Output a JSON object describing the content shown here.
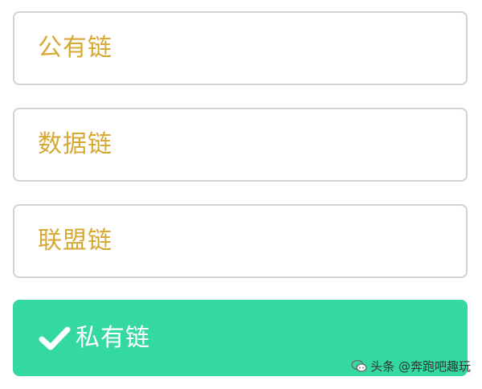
{
  "options": [
    {
      "label": "公有链",
      "selected": false
    },
    {
      "label": "数据链",
      "selected": false
    },
    {
      "label": "联盟链",
      "selected": false
    },
    {
      "label": "私有链",
      "selected": true
    }
  ],
  "colors": {
    "unselected_text": "#d6a935",
    "selected_background": "#33d9a0",
    "selected_text": "#ffffff",
    "border": "#d2d2d2"
  },
  "watermark": {
    "text": "头条 @奔跑吧趣玩",
    "icon": "chat-bubble-logo-icon"
  }
}
